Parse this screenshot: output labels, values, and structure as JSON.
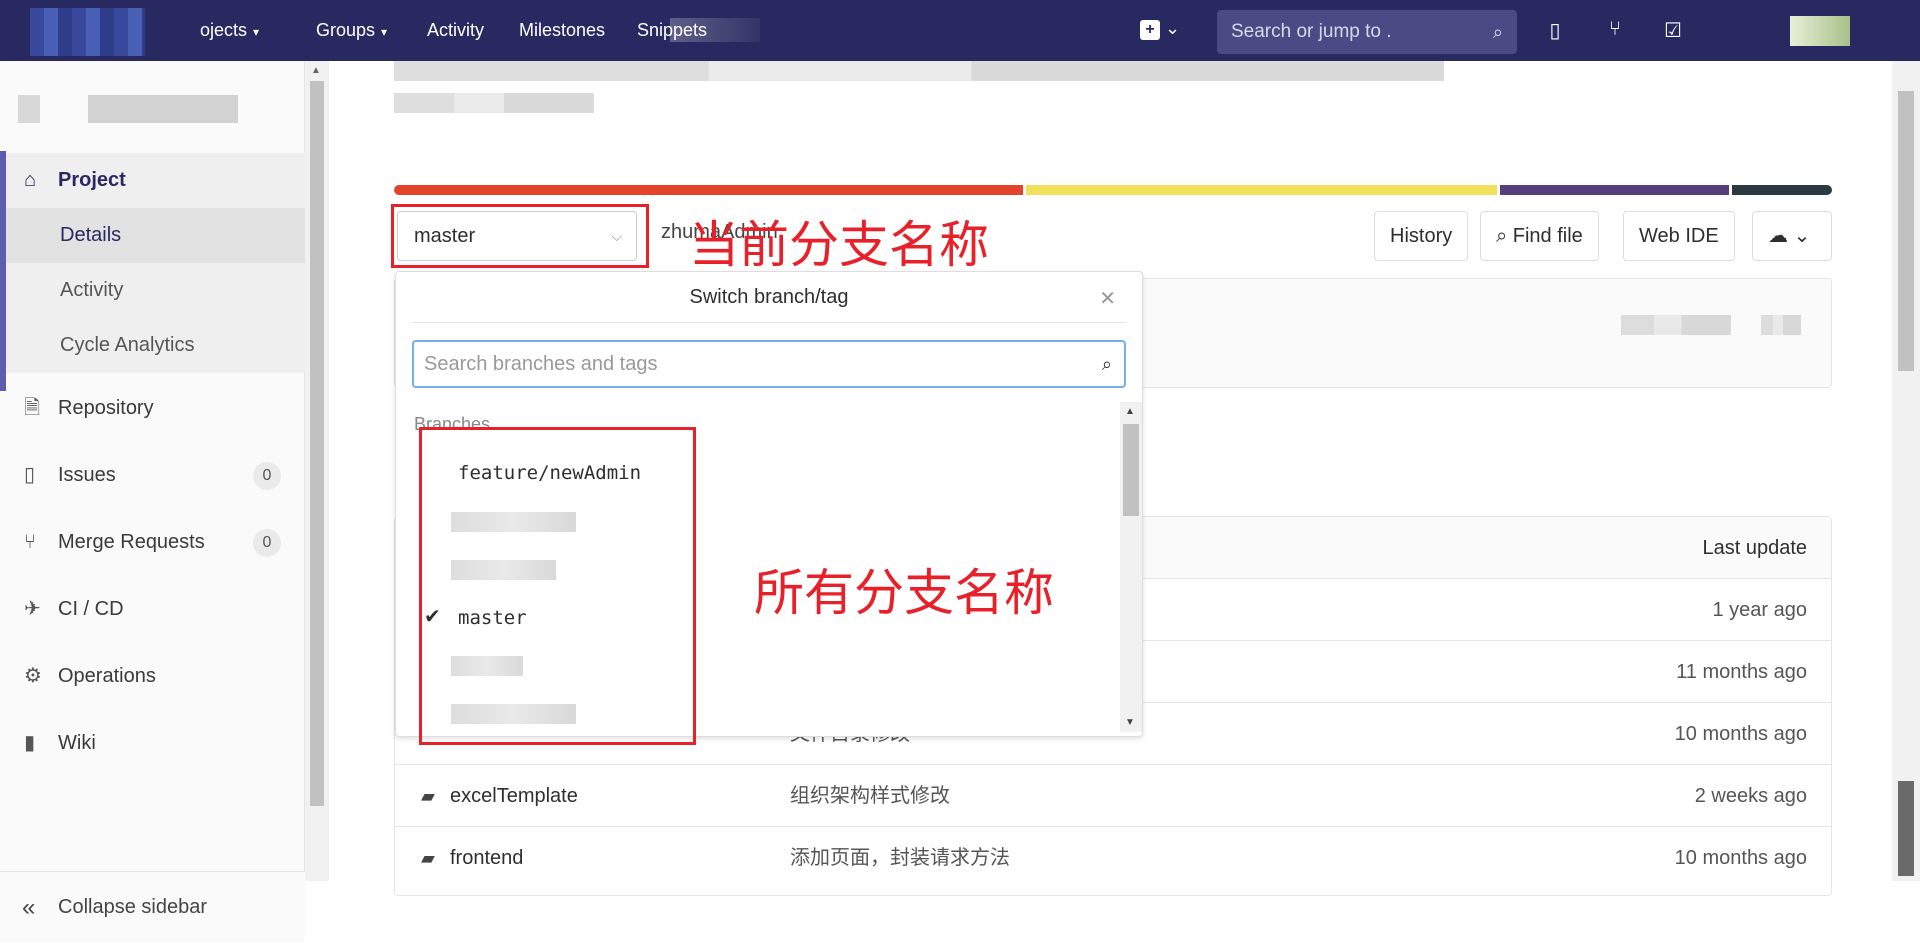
{
  "topbar": {
    "nav": [
      "ojects",
      "Groups",
      "Activity",
      "Milestones",
      "Snippets"
    ],
    "search_placeholder": "Search or jump to ."
  },
  "sidebar": {
    "project_label": "Project",
    "details_label": "Details",
    "activity_label": "Activity",
    "cycle_label": "Cycle Analytics",
    "repository_label": "Repository",
    "issues_label": "Issues",
    "issues_count": "0",
    "mr_label": "Merge Requests",
    "mr_count": "0",
    "cicd_label": "CI / CD",
    "operations_label": "Operations",
    "wiki_label": "Wiki",
    "collapse_label": "Collapse sidebar"
  },
  "repo": {
    "branch": "master",
    "path": "zhumaAdmin",
    "history_label": "History",
    "findfile_label": "Find file",
    "webide_label": "Web IDE",
    "language_colors": [
      "#e24329",
      "#f0e05c",
      "#563d7c",
      "#2b3a42"
    ],
    "language_shares": [
      0.44,
      0.33,
      0.16,
      0.07
    ]
  },
  "annotations": {
    "current_branch": "当前分支名称",
    "all_branches": "所有分支名称"
  },
  "dropdown": {
    "title": "Switch branch/tag",
    "search_placeholder": "Search branches and tags",
    "header": "Branches",
    "items": [
      "feature/newAdmin",
      "master"
    ]
  },
  "files": {
    "last_update_label": "Last update",
    "rows": [
      {
        "name": "",
        "message": "",
        "date": "1 year ago"
      },
      {
        "name": "",
        "message": "",
        "date": "11 months ago"
      },
      {
        "name": "",
        "message": "文件目录修改",
        "date": "10 months ago"
      },
      {
        "name": "excelTemplate",
        "message": "组织架构样式修改",
        "date": "2 weeks ago"
      },
      {
        "name": "frontend",
        "message": "添加页面，封装请求方法",
        "date": "10 months ago"
      }
    ]
  }
}
